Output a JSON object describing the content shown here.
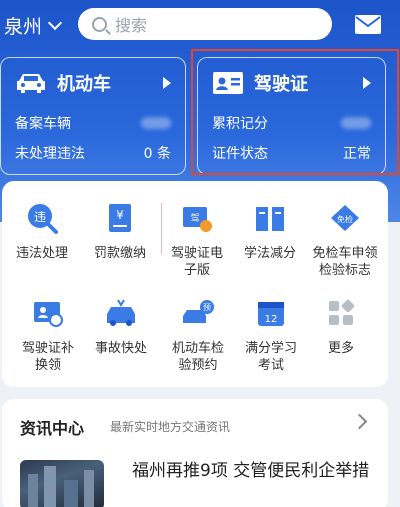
{
  "topbar": {
    "city": "泉州",
    "search_placeholder": "搜索"
  },
  "vehicle_card": {
    "title": "机动车",
    "rows": [
      {
        "label": "备案车辆",
        "value": ""
      },
      {
        "label": "未处理违法",
        "value": "0 条"
      }
    ]
  },
  "license_card": {
    "title": "驾驶证",
    "rows": [
      {
        "label": "累积记分",
        "value": ""
      },
      {
        "label": "证件状态",
        "value": "正常"
      }
    ]
  },
  "services": [
    {
      "label": "违法处理",
      "icon": "violation-search-icon"
    },
    {
      "label": "罚款缴纳",
      "icon": "fine-payment-icon"
    },
    {
      "label": "驾驶证电\n子版",
      "icon": "e-license-icon"
    },
    {
      "label": "学法减分",
      "icon": "book-icon"
    },
    {
      "label": "免检车申领\n检验标志",
      "icon": "exempt-inspection-icon",
      "badge": "免检"
    },
    {
      "label": "驾驶证补\n换领",
      "icon": "license-replace-icon"
    },
    {
      "label": "事故快处",
      "icon": "accident-icon"
    },
    {
      "label": "机动车检\n验预约",
      "icon": "inspection-booking-icon",
      "badge": "预"
    },
    {
      "label": "满分学习\n考试",
      "icon": "calendar-exam-icon",
      "badge": "12"
    },
    {
      "label": "更多",
      "icon": "more-grid-icon"
    }
  ],
  "news": {
    "title": "资讯中心",
    "subtitle": "最新实时地方交通资讯",
    "headline": "福州再推9项 交管便民利企举措"
  },
  "colors": {
    "brand_blue": "#2a68dc",
    "icon_blue": "#3a7be6",
    "highlight_red": "#e5452b"
  }
}
